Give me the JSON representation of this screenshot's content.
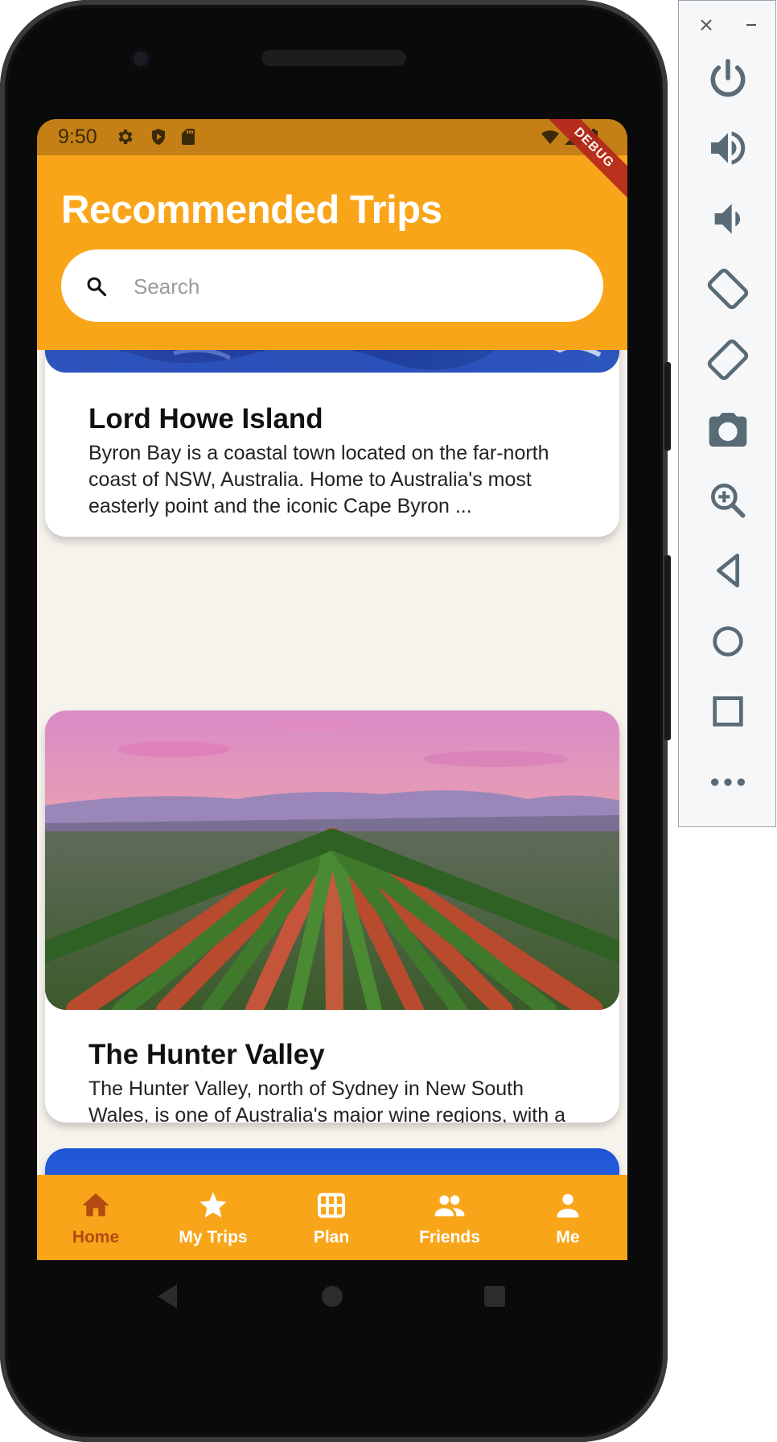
{
  "status": {
    "time": "9:50",
    "debug_label": "DEBUG"
  },
  "appbar": {
    "title": "Recommended Trips"
  },
  "search": {
    "placeholder": "Search",
    "value": ""
  },
  "cards": [
    {
      "title": "Lord Howe Island",
      "description": "Byron Bay is a coastal town located on the far-north coast of NSW, Australia. Home to Australia's most easterly point and the iconic Cape Byron ..."
    },
    {
      "title": "The Hunter Valley",
      "description": "The Hunter Valley, north of Sydney in New South Wales, is one of Australia's major wine regions, with a viticultural history dating back to the early..."
    }
  ],
  "bottom_nav": [
    {
      "label": "Home",
      "icon": "home-icon",
      "active": true
    },
    {
      "label": "My Trips",
      "icon": "star-icon",
      "active": false
    },
    {
      "label": "Plan",
      "icon": "grid-icon",
      "active": false
    },
    {
      "label": "Friends",
      "icon": "people-icon",
      "active": false
    },
    {
      "label": "Me",
      "icon": "person-icon",
      "active": false
    }
  ],
  "emulator_toolbar": [
    "close-icon",
    "minimize-icon",
    "power-icon",
    "volume-up-icon",
    "volume-down-icon",
    "rotate-left-icon",
    "rotate-right-icon",
    "camera-icon",
    "zoom-icon",
    "back-icon",
    "home-circle-icon",
    "overview-icon",
    "more-icon"
  ],
  "colors": {
    "accent": "#f9a51a",
    "status_bar": "#c47f16",
    "active_nav": "#b34a12",
    "card_background": "#ffffff",
    "content_background": "#f6f2ec"
  }
}
